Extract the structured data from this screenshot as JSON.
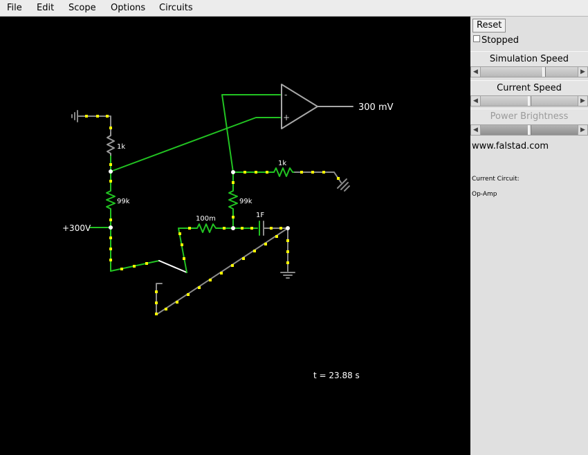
{
  "menu": [
    "File",
    "Edit",
    "Scope",
    "Options",
    "Circuits"
  ],
  "panel": {
    "reset_label": "Reset",
    "stopped_label": "Stopped",
    "stopped_checked": false,
    "sim_speed_label": "Simulation Speed",
    "sim_speed_level": 0.65,
    "current_speed_label": "Current Speed",
    "current_speed_level": 0.5,
    "power_brightness_label": "Power Brightness",
    "power_brightness_level": 0.5,
    "website": "www.falstad.com",
    "current_circuit_label": "Current Circuit:",
    "circuit_name": "Op-Amp"
  },
  "circuit": {
    "r1": "1k",
    "r2": "99k",
    "r3": "1k",
    "r4": "99k",
    "r5": "100m",
    "c1": "1F",
    "source": "+300V",
    "opamp_minus": "-",
    "opamp_plus": "+",
    "output": "300 mV",
    "time": "t = 23.88 s"
  },
  "colors": {
    "menubar": "#ececec",
    "canvas": "#000000",
    "panel": "#e0e0e0",
    "wire_green": "#22c422",
    "wire_gray": "#8c8c8c",
    "current_dot": "#ffff00"
  }
}
